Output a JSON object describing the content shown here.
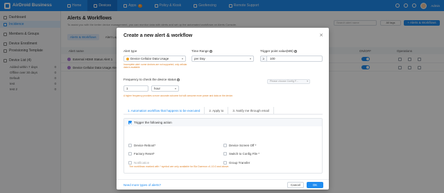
{
  "app": {
    "logo_text": "AirDroid Business",
    "logo_sub": "",
    "admin_name": "Admin"
  },
  "topnav": {
    "items": [
      {
        "label": "Home",
        "icon": "home-icon"
      },
      {
        "label": "Devices",
        "icon": "device-icon",
        "active": true
      },
      {
        "label": "Apps",
        "icon": "apps-icon",
        "badge": "8"
      },
      {
        "label": "Policy & Kiosk",
        "icon": "policy-icon"
      },
      {
        "label": "Geofencing",
        "icon": "geofence-icon"
      },
      {
        "label": "Remote Support",
        "icon": "remote-icon"
      }
    ]
  },
  "sidebar": {
    "items": [
      {
        "label": "Dashboard",
        "icon": "dashboard-icon"
      },
      {
        "label": "Incidence",
        "icon": "incidence-icon",
        "active": true
      },
      {
        "label": "Members & Groups",
        "icon": "members-icon"
      },
      {
        "label": "Device Enrollment",
        "icon": "enroll-icon"
      },
      {
        "label": "Provisioning Template",
        "icon": "template-icon"
      }
    ],
    "device_list_label": "Device List (4)",
    "groups": [
      {
        "label": "Added within 7 days",
        "count": "0"
      },
      {
        "label": "Offline over 30 days",
        "count": "0"
      },
      {
        "label": "Default",
        "count": "0"
      },
      {
        "label": "test",
        "count": "0"
      },
      {
        "label": "test 2",
        "count": "0"
      }
    ]
  },
  "main": {
    "title": "Alerts & Workflows",
    "description": "To assist you with the better device management, you can monitor data with alerts and set up the automated workflows on Alerts Console.",
    "search_placeholder": "Search alert name",
    "all_tags": "All tags",
    "new_button": "+ Alerts & Workflows",
    "sub_tabs": [
      "Alerts & Workflows",
      "Alert Logs"
    ],
    "columns": [
      "Alert name",
      "ON/OFF",
      "Operations"
    ],
    "rows": [
      {
        "name": "External HDMI Status Alert 1"
      },
      {
        "name": "Device Cellular Data Usage Ale..."
      }
    ]
  },
  "modal": {
    "title": "Create a new alert & workflow",
    "alert_type_label": "Alert type",
    "alert_type_value": "Device Cellular Data Usage",
    "alert_type_warning": "Incomplete alert: some devices are not supported; only cellular data is available",
    "time_range_label": "Time Range",
    "time_range_value": "per Day",
    "threshold_label": "Trigger point value(MB)",
    "threshold_op": "≥",
    "threshold_value": "100",
    "frequency_label": "Frequency to check the device status",
    "frequency_value": "1",
    "frequency_unit": "hour",
    "frequency_warning": "A higher frequency provides a more accurate outcome but will consume more power and data on the device.",
    "steps": [
      "1. Automation workflow that happens to be executed",
      "2. Apply to",
      "3. Notify me through email"
    ],
    "trigger_label": "Trigger the following action",
    "options_left": [
      "Device Reboot*",
      "Factory Reset*",
      "Notification"
    ],
    "options_right": [
      "Device Screen Off *",
      "Switch to Config File *",
      "Group Transfer"
    ],
    "config_placeholder": "Please choose Config F...",
    "footnote": "The workflows marked with * symbol are only available for Biz Daemon v1.10.0 and above.",
    "more_link": "Need more types of alerts?",
    "cancel": "Cancel",
    "ok": "OK"
  }
}
